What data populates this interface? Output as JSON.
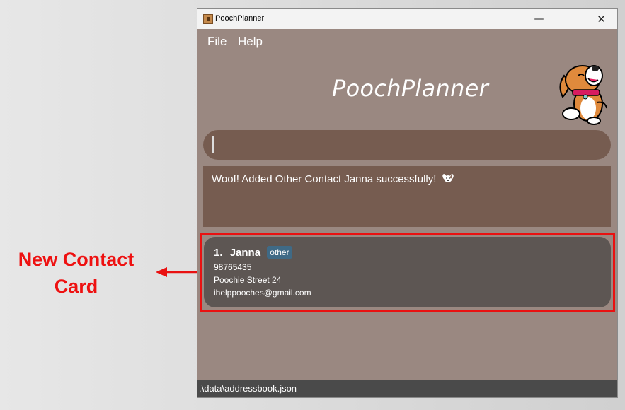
{
  "annotation": {
    "line1": "New Contact",
    "line2": "Card",
    "color": "#ee1111"
  },
  "window": {
    "title": "PoochPlanner",
    "controls": {
      "minimize_icon": "minimize-icon",
      "maximize_icon": "maximize-icon",
      "close_icon": "close-icon"
    }
  },
  "menu": {
    "file": "File",
    "help": "Help"
  },
  "header": {
    "title": "PoochPlanner",
    "mascot_icon": "dog-mascot-icon"
  },
  "command": {
    "value": "",
    "placeholder": ""
  },
  "result": {
    "message": "Woof! Added Other Contact Janna successfully!",
    "icon": "dog-face-icon"
  },
  "contacts": [
    {
      "index": "1.",
      "name": "Janna",
      "tag": "other",
      "phone": "98765435",
      "address": "Poochie Street 24",
      "email": "ihelppooches@gmail.com"
    }
  ],
  "status": {
    "path": ".\\data\\addressbook.json"
  },
  "colors": {
    "background": "#9a8881",
    "command_box": "#765c50",
    "card": "#5d5653",
    "tag": "#3f6a86",
    "highlight": "#e91111",
    "status_bar": "#4a4a4a"
  }
}
